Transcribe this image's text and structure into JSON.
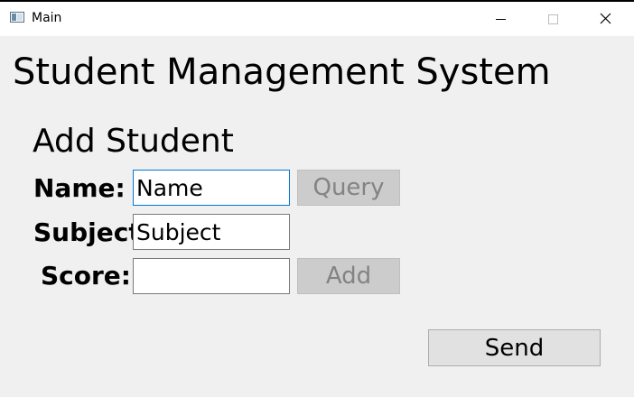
{
  "window": {
    "title": "Main"
  },
  "app": {
    "title": "Student Management System"
  },
  "form": {
    "section_title": "Add Student",
    "name_label": "Name:",
    "name_value": "Name",
    "subject_label": "Subject:",
    "subject_value": "Subject",
    "score_label": "Score:",
    "score_value": ""
  },
  "buttons": {
    "query_label": "Query",
    "add_label": "Add",
    "send_label": "Send"
  },
  "icons": {
    "app": "window-app-icon",
    "minimize": "minimize-icon",
    "maximize": "maximize-icon",
    "close": "close-icon"
  },
  "colors": {
    "focus_border": "#0078d7",
    "disabled_text": "#838383",
    "background": "#f0f0f0"
  }
}
